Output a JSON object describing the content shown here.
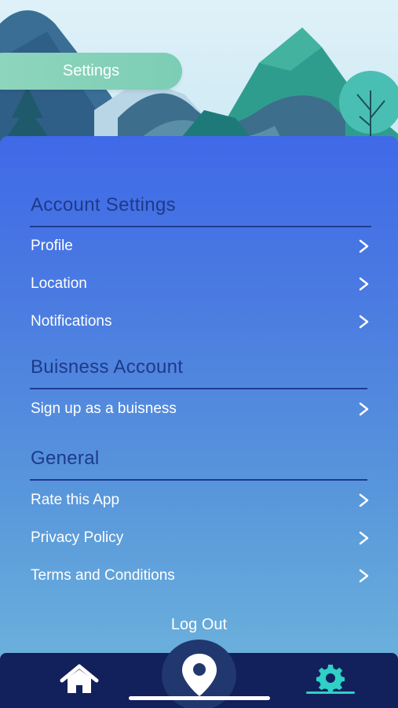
{
  "header": {
    "title": "Settings"
  },
  "sections": [
    {
      "title": "Account Settings",
      "items": [
        {
          "label": "Profile"
        },
        {
          "label": "Location"
        },
        {
          "label": "Notifications"
        }
      ]
    },
    {
      "title": "Buisness Account",
      "items": [
        {
          "label": "Sign up as a buisness"
        }
      ]
    },
    {
      "title": "General",
      "items": [
        {
          "label": "Rate this App"
        },
        {
          "label": "Privacy Policy"
        },
        {
          "label": "Terms and Conditions"
        }
      ]
    }
  ],
  "footer": {
    "logout_label": "Log Out"
  },
  "tabbar": {
    "tabs": [
      {
        "icon": "home-icon"
      },
      {
        "icon": "map-pin-icon"
      },
      {
        "icon": "gear-icon",
        "active": true
      }
    ]
  },
  "colors": {
    "accent": "#2fd0c5",
    "section_title": "#1e3a8a",
    "panel_top": "#3f69e8",
    "panel_bottom": "#6cb2dc",
    "tabbar": "#12205c"
  }
}
